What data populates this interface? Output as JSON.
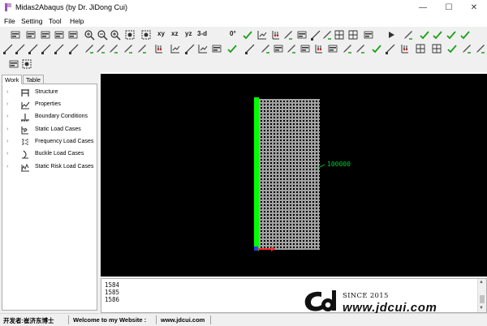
{
  "window": {
    "title": "Midas2Abaqus (by Dr. JiDong Cui)",
    "minimize_glyph": "—",
    "maximize_glyph": "☐",
    "close_glyph": "✕"
  },
  "menu": [
    "File",
    "Setting",
    "Tool",
    "Help"
  ],
  "toolbar": {
    "axis_labels": [
      "xy",
      "xz",
      "yz",
      "3-d"
    ],
    "angle_label": "0°"
  },
  "tabs": [
    "Work",
    "Table"
  ],
  "tree": [
    {
      "label": "Structure",
      "icon": "structure-icon"
    },
    {
      "label": "Properties",
      "icon": "properties-icon"
    },
    {
      "label": "Boundary Conditions",
      "icon": "boundary-icon"
    },
    {
      "label": "Static Load Cases",
      "icon": "static-load-icon"
    },
    {
      "label": "Frequency Load Cases",
      "icon": "frequency-load-icon"
    },
    {
      "label": "Buckle Load Cases",
      "icon": "buckle-load-icon"
    },
    {
      "label": "Static Risk Load Cases",
      "icon": "risk-load-icon"
    }
  ],
  "viewport": {
    "node_label": "100000",
    "colors": {
      "background": "#000000",
      "mesh": "#e8e8e8",
      "boundary": "#00ff00",
      "x_axis": "#ff3030",
      "y_axis": "#00cc00",
      "label": "#00cc33"
    }
  },
  "console": {
    "lines": [
      "1584",
      "1585",
      "1586"
    ]
  },
  "watermark": {
    "since": "SINCE 2015",
    "url": "www.jdcui.com"
  },
  "status": {
    "developer": "开发者:崔济东博士",
    "welcome": "Welcome to my Website :",
    "website": "www.jdcui.com"
  }
}
